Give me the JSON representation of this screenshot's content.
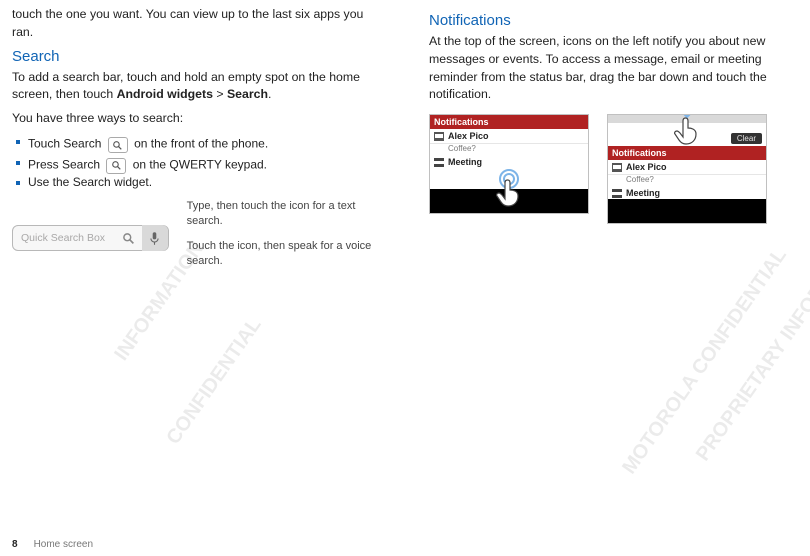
{
  "left": {
    "intro": "touch the one you want. You can view up to the last six apps you ran.",
    "search_head": "Search",
    "search_intro_pre": "To add a search bar, touch and hold an empty spot on the home screen, then touch ",
    "search_intro_bold": "Android widgets",
    "search_intro_mid": " > ",
    "search_intro_bold2": "Search",
    "search_intro_end": ".",
    "three_ways": "You have three ways to search:",
    "b1_pre": "Touch Search ",
    "b1_post": " on the front of the phone.",
    "b2_pre": "Press Search ",
    "b2_post": " on the QWERTY keypad.",
    "b3": "Use the Search widget.",
    "qsb_placeholder": "Quick Search Box",
    "callout1": "Type, then touch the icon for a text search.",
    "callout2": "Touch the icon, then speak for a voice search."
  },
  "right": {
    "head": "Notifications",
    "para": "At the top of the screen, icons on the left notify you about new messages or events. To access a message, email or meeting reminder from the status bar, drag the bar down and touch the notification.",
    "panel1": {
      "head": "Notifications",
      "name": "Alex Pico",
      "sub": "Coffee?",
      "meet": "Meeting"
    },
    "panel2": {
      "clear": "Clear",
      "head": "Notifications",
      "name": "Alex Pico",
      "sub": "Coffee?",
      "meet": "Meeting"
    }
  },
  "footer": {
    "page": "8",
    "section": "Home screen"
  },
  "watermarks": {
    "a": "CONFIDENTIAL",
    "b": "INFORMATION",
    "c": "MOTOROLA CONFIDENTIAL",
    "d": "PROPRIETARY INFORMATION"
  }
}
